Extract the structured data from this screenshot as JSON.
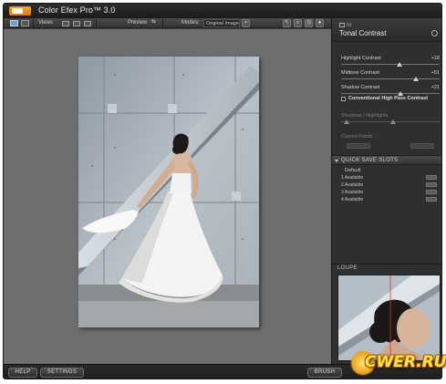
{
  "window": {
    "title": "Color Efex Pro™ 3.0"
  },
  "toolbar": {
    "views_label": "Views",
    "preview_label": "Preview",
    "modes_label": "Modes:",
    "modes_value": "Original Image"
  },
  "filter_panel": {
    "section": "NI",
    "title": "Tonal Contrast",
    "sliders": [
      {
        "label": "Highlight Contrast",
        "value": "+18",
        "level": 0.59
      },
      {
        "label": "Midtone Contrast",
        "value": "+51",
        "level": 0.76
      },
      {
        "label": "Shadow Contrast",
        "value": "+21",
        "level": 0.6
      }
    ],
    "checkbox_label": "Conventional High Pass Contrast",
    "checkbox_checked": false,
    "shadows_highlights_label": "Shadows / Highlights",
    "control_points_label": "Control Points"
  },
  "quick_save": {
    "title": "QUICK SAVE SLOTS",
    "default_label": "Default",
    "slots": [
      {
        "label": "1  Available"
      },
      {
        "label": "2  Available"
      },
      {
        "label": "3  Available"
      },
      {
        "label": "4  Available"
      }
    ]
  },
  "loupe": {
    "title": "LOUPE"
  },
  "bottom": {
    "help_label": "HELP",
    "settings_label": "SETTINGS",
    "brush_label": "BRUSH"
  },
  "watermark": {
    "text": "CWER.RU"
  },
  "colors": {
    "accent_orange": "#f29a1a",
    "panel_bg": "#2f2f2f",
    "canvas_bg": "#6e6e6e"
  }
}
